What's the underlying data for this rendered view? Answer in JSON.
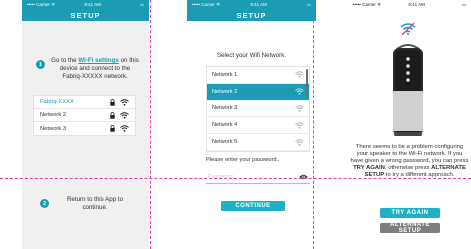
{
  "screen1": {
    "status": {
      "carrier": "••••• Carrier ᯤ",
      "time": "9:41 AM"
    },
    "title": "SETUP",
    "step1": {
      "number": "1",
      "text_before": "Go to the ",
      "link": "Wi-Fi settings",
      "text_after": " on this device and connect to the Fabriq-XXXXX network."
    },
    "networks": [
      {
        "name": "Fabriq-XXXX",
        "selected": true,
        "locked": true
      },
      {
        "name": "Network 2",
        "selected": false,
        "locked": true
      },
      {
        "name": "Network 3",
        "selected": false,
        "locked": true
      }
    ],
    "step2": {
      "number": "2",
      "text": "Return to this App to continue."
    }
  },
  "screen2": {
    "status": {
      "carrier": "••••• Carrier ᯤ",
      "time": "9:41 AM"
    },
    "title": "SETUP",
    "select_prompt": "Select your Wifi Network.",
    "networks": [
      {
        "name": "Network 1",
        "active": false
      },
      {
        "name": "Network 2",
        "active": true
      },
      {
        "name": "Network 3",
        "active": false
      },
      {
        "name": "Network 4",
        "active": false
      },
      {
        "name": "Network 5",
        "active": false
      }
    ],
    "password_label": "Please enter your password..",
    "password_placeholder": "Password",
    "continue_label": "CONTINUE"
  },
  "screen3": {
    "status": {
      "carrier": "••••• Carrier ᯤ",
      "time": "9:41 AM"
    },
    "error": {
      "p1": "There seems to be a problem configuring your speaker to the Wi-Fi network. If you have given a wrong password, you can press ",
      "b1": "TRY AGAIN",
      "p2": ", otherwise press ",
      "b2": "ALTERNATE SETUP",
      "p3": " to try a different approach."
    },
    "try_again_label": "TRY AGAIN",
    "alternate_setup_label": "ALTERNATE SETUP"
  },
  "colors": {
    "accent": "#1b9cb4",
    "guide": "#e0479d",
    "gray_button": "#7d7d7d"
  },
  "icons": [
    "wifi-icon",
    "lock-icon",
    "eye-icon",
    "no-wifi-icon",
    "speaker-image"
  ]
}
